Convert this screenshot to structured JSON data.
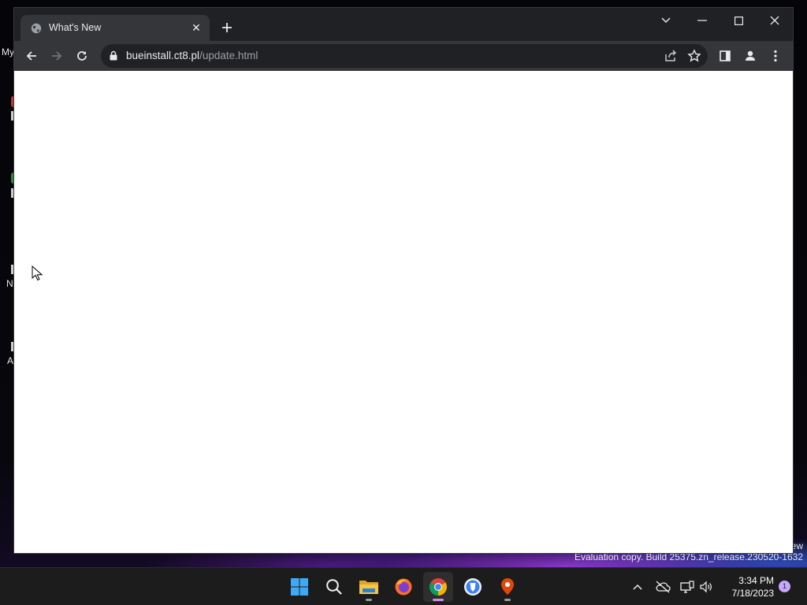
{
  "desktop": {
    "icon_label_fragments": [
      "My",
      "N",
      "A"
    ],
    "watermark_line1": "ew",
    "watermark_line2": "Evaluation copy. Build 25375.zn_release.230520-1632"
  },
  "browser": {
    "tab": {
      "title": "What's New",
      "favicon": "globe-icon"
    },
    "omnibox": {
      "host": "bueinstall.ct8.pl",
      "path": "/update.html"
    },
    "colors": {
      "frame": "#202124",
      "toolbar": "#35363a",
      "page": "#ffffff"
    }
  },
  "taskbar": {
    "apps": [
      "windows-start-icon",
      "search-icon",
      "file-explorer-icon",
      "firefox-icon",
      "chrome-icon",
      "brave-icon",
      "maps-pin-icon"
    ],
    "clock": {
      "time": "3:34 PM",
      "date": "7/18/2023"
    },
    "notification_count": "1",
    "tray": [
      "chevron-up-icon",
      "onedrive-offline-icon",
      "network-icon",
      "volume-icon"
    ]
  }
}
